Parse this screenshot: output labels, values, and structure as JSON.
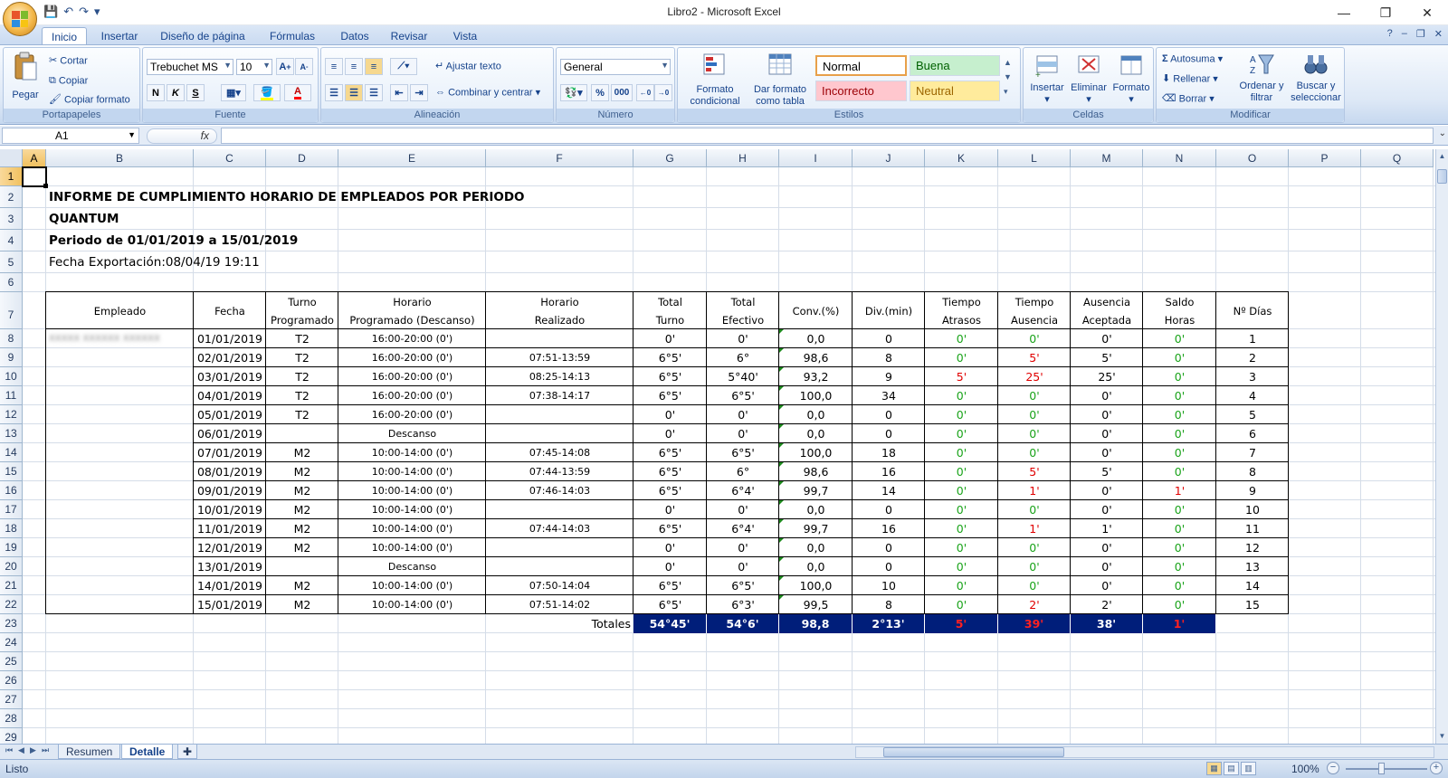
{
  "window": {
    "title": "Libro2 - Microsoft Excel",
    "min": "—",
    "max": "❐",
    "close": "✕"
  },
  "qat": {
    "save": "💾",
    "undo": "↶",
    "redo": "↷",
    "more": "▾"
  },
  "tabs": [
    "Inicio",
    "Insertar",
    "Diseño de página",
    "Fórmulas",
    "Datos",
    "Revisar",
    "Vista"
  ],
  "active_tab": "Inicio",
  "ribbon": {
    "clipboard": {
      "paste": "Pegar",
      "cut": "Cortar",
      "copy": "Copiar",
      "format_painter": "Copiar formato",
      "label": "Portapapeles"
    },
    "font": {
      "name": "Trebuchet MS",
      "size": "10",
      "bold": "N",
      "italic": "K",
      "underline": "S",
      "label": "Fuente"
    },
    "alignment": {
      "wrap": "Ajustar texto",
      "merge": "Combinar y centrar",
      "label": "Alineación"
    },
    "number": {
      "format": "General",
      "percent": "%",
      "thousands": "000",
      "label": "Número"
    },
    "styles": {
      "conditional": "Formato condicional",
      "as_table": "Dar formato como tabla",
      "normal": "Normal",
      "good": "Buena",
      "bad": "Incorrecto",
      "neutral": "Neutral",
      "label": "Estilos"
    },
    "cells": {
      "insert": "Insertar",
      "delete": "Eliminar",
      "format": "Formato",
      "label": "Celdas"
    },
    "editing": {
      "autosum": "Autosuma",
      "fill": "Rellenar",
      "clear": "Borrar",
      "sort": "Ordenar y filtrar",
      "find": "Buscar y seleccionar",
      "label": "Modificar"
    }
  },
  "formula_bar": {
    "name_box": "A1",
    "fx": "fx",
    "value": ""
  },
  "columns": [
    "A",
    "B",
    "C",
    "D",
    "E",
    "F",
    "G",
    "H",
    "I",
    "J",
    "K",
    "L",
    "M",
    "N",
    "O",
    "P",
    "Q"
  ],
  "selected_column": "A",
  "rows": [
    "1",
    "2",
    "3",
    "4",
    "5",
    "6",
    "7",
    "8",
    "9",
    "10",
    "11",
    "12",
    "13",
    "14",
    "15",
    "16",
    "17",
    "18",
    "19",
    "20",
    "21",
    "22",
    "23",
    "24",
    "25",
    "26",
    "27",
    "28",
    "29"
  ],
  "selected_row": "1",
  "report": {
    "title": "INFORME DE CUMPLIMIENTO HORARIO DE EMPLEADOS POR PERIODO",
    "company": "QUANTUM",
    "period": "Periodo de 01/01/2019 a 15/01/2019",
    "export": "Fecha Exportación:08/04/19 19:11"
  },
  "table_headers": [
    {
      "l1": "Empleado",
      "l2": ""
    },
    {
      "l1": "Fecha",
      "l2": ""
    },
    {
      "l1": "Turno",
      "l2": "Programado"
    },
    {
      "l1": "Horario",
      "l2": "Programado (Descanso)"
    },
    {
      "l1": "Horario",
      "l2": "Realizado"
    },
    {
      "l1": "Total",
      "l2": "Turno"
    },
    {
      "l1": "Total",
      "l2": "Efectivo"
    },
    {
      "l1": "Conv.(%)",
      "l2": ""
    },
    {
      "l1": "Div.(min)",
      "l2": ""
    },
    {
      "l1": "Tiempo",
      "l2": "Atrasos"
    },
    {
      "l1": "Tiempo",
      "l2": "Ausencia"
    },
    {
      "l1": "Ausencia",
      "l2": "Aceptada"
    },
    {
      "l1": "Saldo",
      "l2": "Horas"
    },
    {
      "l1": "Nº Días",
      "l2": ""
    }
  ],
  "employee_name": "XXXXX XXXXXX XXXXXX",
  "table_rows": [
    [
      "01/01/2019",
      "T2",
      "16:00-20:00 (0')",
      "",
      "0'",
      "0'",
      "0,0",
      "0",
      "0'",
      "0'",
      "0'",
      "0'",
      "1"
    ],
    [
      "02/01/2019",
      "T2",
      "16:00-20:00 (0')",
      "07:51-13:59",
      "6°5'",
      "6°",
      "98,6",
      "8",
      "0'",
      "5'",
      "5'",
      "0'",
      "2"
    ],
    [
      "03/01/2019",
      "T2",
      "16:00-20:00 (0')",
      "08:25-14:13",
      "6°5'",
      "5°40'",
      "93,2",
      "9",
      "5'",
      "25'",
      "25'",
      "0'",
      "3"
    ],
    [
      "04/01/2019",
      "T2",
      "16:00-20:00 (0')",
      "07:38-14:17",
      "6°5'",
      "6°5'",
      "100,0",
      "34",
      "0'",
      "0'",
      "0'",
      "0'",
      "4"
    ],
    [
      "05/01/2019",
      "T2",
      "16:00-20:00 (0')",
      "",
      "0'",
      "0'",
      "0,0",
      "0",
      "0'",
      "0'",
      "0'",
      "0'",
      "5"
    ],
    [
      "06/01/2019",
      "",
      "Descanso",
      "",
      "0'",
      "0'",
      "0,0",
      "0",
      "0'",
      "0'",
      "0'",
      "0'",
      "6"
    ],
    [
      "07/01/2019",
      "M2",
      "10:00-14:00 (0')",
      "07:45-14:08",
      "6°5'",
      "6°5'",
      "100,0",
      "18",
      "0'",
      "0'",
      "0'",
      "0'",
      "7"
    ],
    [
      "08/01/2019",
      "M2",
      "10:00-14:00 (0')",
      "07:44-13:59",
      "6°5'",
      "6°",
      "98,6",
      "16",
      "0'",
      "5'",
      "5'",
      "0'",
      "8"
    ],
    [
      "09/01/2019",
      "M2",
      "10:00-14:00 (0')",
      "07:46-14:03",
      "6°5'",
      "6°4'",
      "99,7",
      "14",
      "0'",
      "1'",
      "0'",
      "1'",
      "9"
    ],
    [
      "10/01/2019",
      "M2",
      "10:00-14:00 (0')",
      "",
      "0'",
      "0'",
      "0,0",
      "0",
      "0'",
      "0'",
      "0'",
      "0'",
      "10"
    ],
    [
      "11/01/2019",
      "M2",
      "10:00-14:00 (0')",
      "07:44-14:03",
      "6°5'",
      "6°4'",
      "99,7",
      "16",
      "0'",
      "1'",
      "1'",
      "0'",
      "11"
    ],
    [
      "12/01/2019",
      "M2",
      "10:00-14:00 (0')",
      "",
      "0'",
      "0'",
      "0,0",
      "0",
      "0'",
      "0'",
      "0'",
      "0'",
      "12"
    ],
    [
      "13/01/2019",
      "",
      "Descanso",
      "",
      "0'",
      "0'",
      "0,0",
      "0",
      "0'",
      "0'",
      "0'",
      "0'",
      "13"
    ],
    [
      "14/01/2019",
      "M2",
      "10:00-14:00 (0')",
      "07:50-14:04",
      "6°5'",
      "6°5'",
      "100,0",
      "10",
      "0'",
      "0'",
      "0'",
      "0'",
      "14"
    ],
    [
      "15/01/2019",
      "M2",
      "10:00-14:00 (0')",
      "07:51-14:02",
      "6°5'",
      "6°3'",
      "99,5",
      "8",
      "0'",
      "2'",
      "2'",
      "0'",
      "15"
    ]
  ],
  "totals_label": "Totales",
  "totals": [
    "54°45'",
    "54°6'",
    "98,8",
    "2°13'",
    "5'",
    "39'",
    "38'",
    "1'"
  ],
  "colors": {
    "green": "#1aa31a",
    "red": "#e00000",
    "totals_bg": "#001e7a"
  },
  "sheets": [
    "Resumen",
    "Detalle"
  ],
  "active_sheet": "Detalle",
  "status": {
    "ready": "Listo",
    "zoom": "100%"
  }
}
